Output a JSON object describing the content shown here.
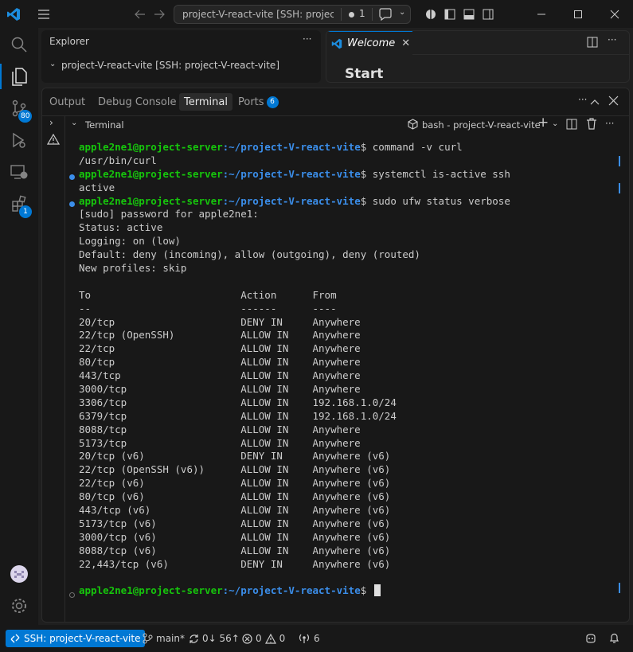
{
  "titlebar": {
    "command_center": "project-V-react-vite [SSH: project-...",
    "notif_count": "1"
  },
  "activity": {
    "scm_badge": "80",
    "extensions_badge": "1"
  },
  "explorer": {
    "title": "Explorer",
    "more": "···",
    "root": "project-V-react-vite [SSH: project-V-react-vite]"
  },
  "editor": {
    "tab_label": "Welcome",
    "heading": "Start"
  },
  "panel": {
    "tabs": [
      "Output",
      "Debug Console",
      "Terminal",
      "Ports"
    ],
    "ports_badge": "6",
    "more": "···",
    "section_title": "Terminal",
    "terminal_name": "bash - project-V-react-vite",
    "add": "+"
  },
  "terminal": {
    "user_host": "apple2ne1@project-server",
    "path": ":~/project-V-react-vite",
    "lines": [
      {
        "type": "prompt",
        "cmd": "$ command -v curl"
      },
      {
        "type": "out",
        "text": "/usr/bin/curl"
      },
      {
        "type": "prompt",
        "cmd": "$ systemctl is-active ssh"
      },
      {
        "type": "out",
        "text": "active"
      },
      {
        "type": "prompt",
        "cmd": "$ sudo ufw status verbose"
      },
      {
        "type": "out",
        "text": "[sudo] password for apple2ne1:"
      },
      {
        "type": "out",
        "text": "Status: active"
      },
      {
        "type": "out",
        "text": "Logging: on (low)"
      },
      {
        "type": "out",
        "text": "Default: deny (incoming), allow (outgoing), deny (routed)"
      },
      {
        "type": "out",
        "text": "New profiles: skip"
      },
      {
        "type": "out",
        "text": ""
      },
      {
        "type": "out",
        "text": "To                         Action      From"
      },
      {
        "type": "out",
        "text": "--                         ------      ----"
      },
      {
        "type": "out",
        "text": "20/tcp                     DENY IN     Anywhere"
      },
      {
        "type": "out",
        "text": "22/tcp (OpenSSH)           ALLOW IN    Anywhere"
      },
      {
        "type": "out",
        "text": "22/tcp                     ALLOW IN    Anywhere"
      },
      {
        "type": "out",
        "text": "80/tcp                     ALLOW IN    Anywhere"
      },
      {
        "type": "out",
        "text": "443/tcp                    ALLOW IN    Anywhere"
      },
      {
        "type": "out",
        "text": "3000/tcp                   ALLOW IN    Anywhere"
      },
      {
        "type": "out",
        "text": "3306/tcp                   ALLOW IN    192.168.1.0/24"
      },
      {
        "type": "out",
        "text": "6379/tcp                   ALLOW IN    192.168.1.0/24"
      },
      {
        "type": "out",
        "text": "8088/tcp                   ALLOW IN    Anywhere"
      },
      {
        "type": "out",
        "text": "5173/tcp                   ALLOW IN    Anywhere"
      },
      {
        "type": "out",
        "text": "20/tcp (v6)                DENY IN     Anywhere (v6)"
      },
      {
        "type": "out",
        "text": "22/tcp (OpenSSH (v6))      ALLOW IN    Anywhere (v6)"
      },
      {
        "type": "out",
        "text": "22/tcp (v6)                ALLOW IN    Anywhere (v6)"
      },
      {
        "type": "out",
        "text": "80/tcp (v6)                ALLOW IN    Anywhere (v6)"
      },
      {
        "type": "out",
        "text": "443/tcp (v6)               ALLOW IN    Anywhere (v6)"
      },
      {
        "type": "out",
        "text": "5173/tcp (v6)              ALLOW IN    Anywhere (v6)"
      },
      {
        "type": "out",
        "text": "3000/tcp (v6)              ALLOW IN    Anywhere (v6)"
      },
      {
        "type": "out",
        "text": "8088/tcp (v6)              ALLOW IN    Anywhere (v6)"
      },
      {
        "type": "out",
        "text": "22,443/tcp (v6)            DENY IN     Anywhere (v6)"
      },
      {
        "type": "out",
        "text": ""
      },
      {
        "type": "prompt",
        "cmd": "$ "
      }
    ]
  },
  "statusbar": {
    "remote": "SSH: project-V-react-vite",
    "branch": "main*",
    "sync": "0↓ 56↑",
    "errors": "0",
    "warnings": "0",
    "ports": "6"
  },
  "colors": {
    "accent": "#0078d4",
    "prompt_user": "#16c60c",
    "prompt_path": "#3b8eea"
  }
}
